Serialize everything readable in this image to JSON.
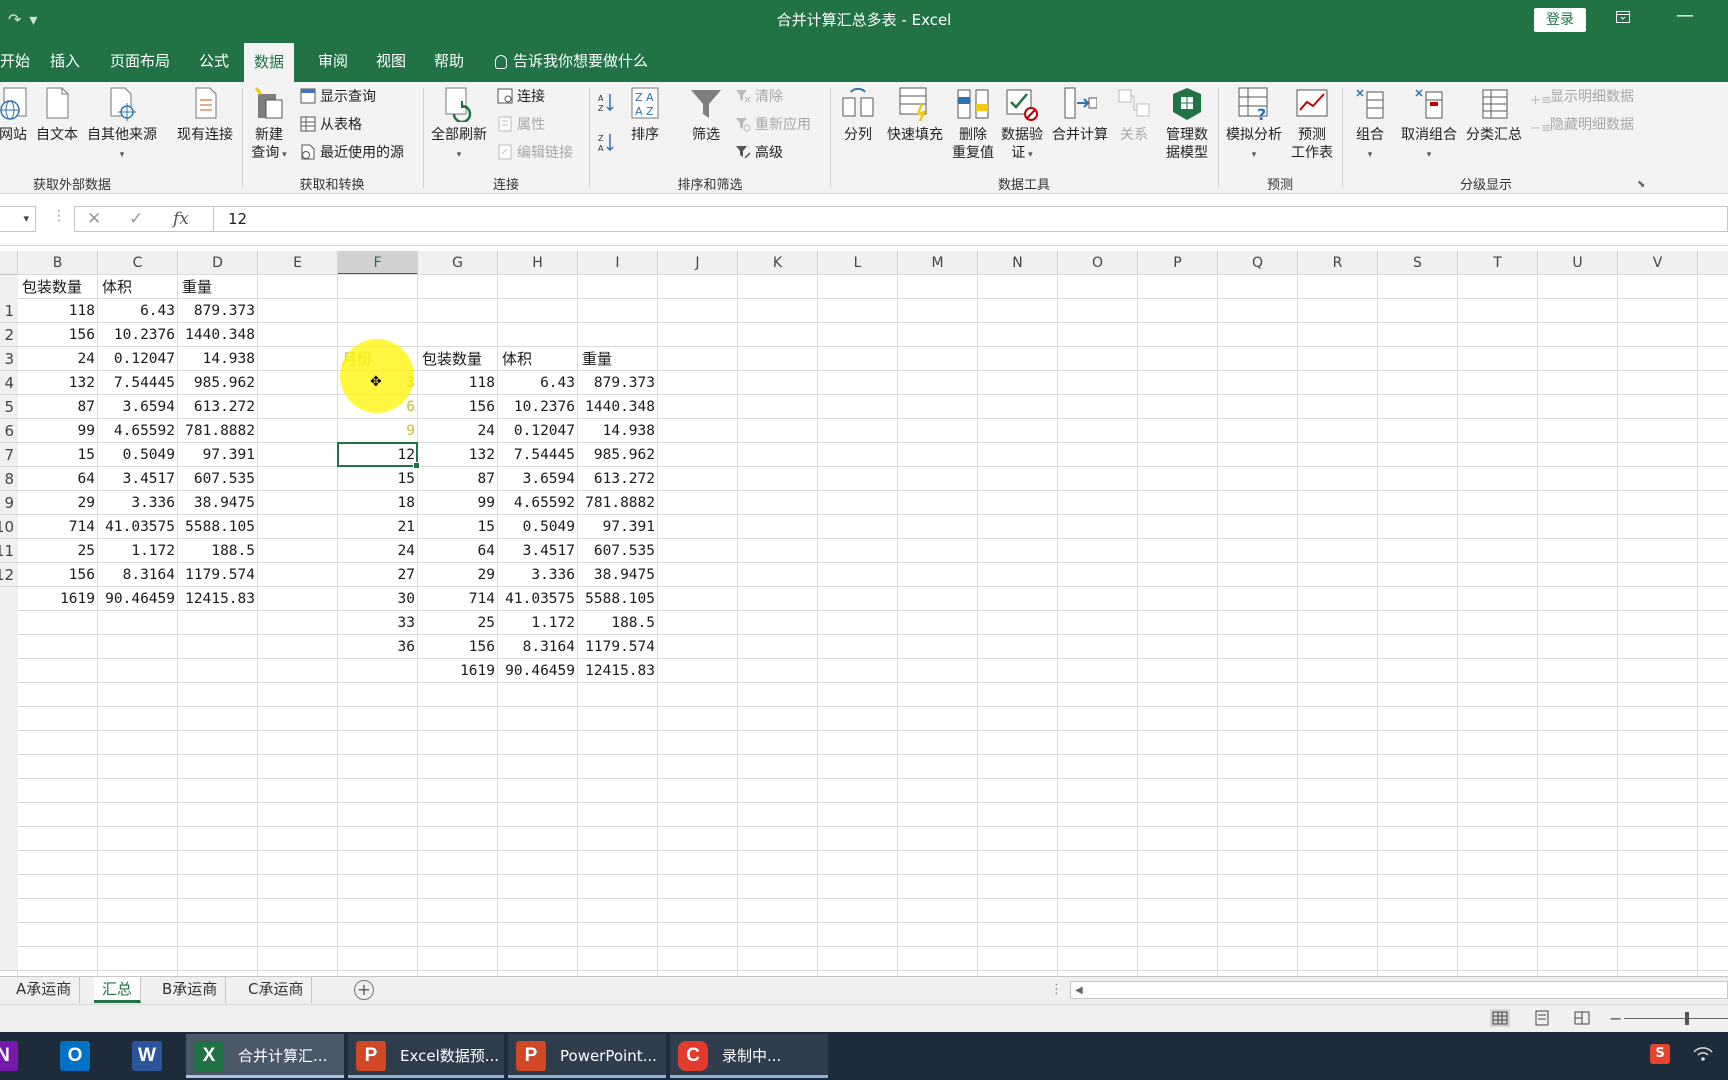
{
  "window": {
    "title": "合并计算汇总多表 - Excel",
    "login_label": "登录",
    "restore_icon": "ribbon-display-icon",
    "minimize_glyph": "—"
  },
  "tabs": [
    "开始",
    "插入",
    "页面布局",
    "公式",
    "数据",
    "审阅",
    "视图",
    "帮助"
  ],
  "active_tab": "数据",
  "tell_me": "告诉我你想要做什么",
  "ribbon": {
    "get_external": {
      "label": "获取外部数据",
      "buttons": [
        "网站",
        "自文本",
        "自其他来源",
        "现有连接"
      ]
    },
    "get_transform": {
      "label": "获取和转换",
      "new_query_line1": "新建",
      "new_query_line2": "查询",
      "small": [
        "显示查询",
        "从表格",
        "最近使用的源"
      ]
    },
    "connections": {
      "label": "连接",
      "refresh_all": "全部刷新",
      "small": [
        "连接",
        "属性",
        "编辑链接"
      ]
    },
    "sort_filter": {
      "label": "排序和筛选",
      "sort": "排序",
      "filter": "筛选",
      "small": [
        "清除",
        "重新应用",
        "高级"
      ]
    },
    "data_tools": {
      "label": "数据工具",
      "split": "分列",
      "flash_fill": "快速填充",
      "remove_dup_line1": "删除",
      "remove_dup_line2": "重复值",
      "validation_line1": "数据验",
      "validation_line2": "证",
      "consolidate": "合并计算",
      "relationships": "关系",
      "data_model_line1": "管理数",
      "data_model_line2": "据模型"
    },
    "forecast": {
      "label": "预测",
      "what_if": "模拟分析",
      "forecast_sheet_line1": "预测",
      "forecast_sheet_line2": "工作表"
    },
    "outline": {
      "label": "分级显示",
      "group": "组合",
      "ungroup": "取消组合",
      "subtotal": "分类汇总",
      "show_detail": "显示明细数据",
      "hide_detail": "隐藏明细数据"
    }
  },
  "formula_bar": {
    "cancel_glyph": "✕",
    "enter_glyph": "✓",
    "fx_label": "fx",
    "value": "12"
  },
  "columns": [
    "B",
    "C",
    "D",
    "E",
    "F",
    "G",
    "H",
    "I",
    "J",
    "K",
    "L",
    "M",
    "N",
    "O",
    "P",
    "Q",
    "R",
    "S",
    "T",
    "U",
    "V"
  ],
  "selected_column": "F",
  "row_headers": [
    "1",
    "2",
    "3",
    "4",
    "5",
    "6",
    "7",
    "8",
    "9",
    "10",
    "11",
    "12"
  ],
  "left_table": {
    "headers": [
      "包装数量",
      "体积",
      "重量"
    ],
    "rows": [
      [
        "118",
        "6.43",
        "879.373"
      ],
      [
        "156",
        "10.2376",
        "1440.348"
      ],
      [
        "24",
        "0.12047",
        "14.938"
      ],
      [
        "132",
        "7.54445",
        "985.962"
      ],
      [
        "87",
        "3.6594",
        "613.272"
      ],
      [
        "99",
        "4.65592",
        "781.8882"
      ],
      [
        "15",
        "0.5049",
        "97.391"
      ],
      [
        "64",
        "3.4517",
        "607.535"
      ],
      [
        "29",
        "3.336",
        "38.9475"
      ],
      [
        "714",
        "41.03575",
        "5588.105"
      ],
      [
        "25",
        "1.172",
        "188.5"
      ],
      [
        "156",
        "8.3164",
        "1179.574"
      ],
      [
        "1619",
        "90.46459",
        "12415.83"
      ]
    ]
  },
  "right_table": {
    "headers": [
      "月份",
      "包装数量",
      "体积",
      "重量"
    ],
    "rows": [
      [
        "3",
        "118",
        "6.43",
        "879.373"
      ],
      [
        "6",
        "156",
        "10.2376",
        "1440.348"
      ],
      [
        "9",
        "24",
        "0.12047",
        "14.938"
      ],
      [
        "12",
        "132",
        "7.54445",
        "985.962"
      ],
      [
        "15",
        "87",
        "3.6594",
        "613.272"
      ],
      [
        "18",
        "99",
        "4.65592",
        "781.8882"
      ],
      [
        "21",
        "15",
        "0.5049",
        "97.391"
      ],
      [
        "24",
        "64",
        "3.4517",
        "607.535"
      ],
      [
        "27",
        "29",
        "3.336",
        "38.9475"
      ],
      [
        "30",
        "714",
        "41.03575",
        "5588.105"
      ],
      [
        "33",
        "25",
        "1.172",
        "188.5"
      ],
      [
        "36",
        "156",
        "8.3164",
        "1179.574"
      ],
      [
        "",
        "1619",
        "90.46459",
        "12415.83"
      ]
    ]
  },
  "sheets": [
    "A承运商",
    "汇总",
    "B承运商",
    "C承运商"
  ],
  "active_sheet": "汇总",
  "add_sheet_glyph": "+",
  "taskbar": {
    "apps": [
      {
        "icon": "onenote-icon",
        "letter": "N",
        "label": ""
      },
      {
        "icon": "outlook-icon",
        "letter": "O",
        "label": ""
      },
      {
        "icon": "word-icon",
        "letter": "W",
        "label": ""
      },
      {
        "icon": "excel-icon",
        "letter": "X",
        "label": "合并计算汇..."
      },
      {
        "icon": "powerpoint-icon",
        "letter": "P",
        "label": "Excel数据预..."
      },
      {
        "icon": "powerpoint-icon",
        "letter": "P",
        "label": "PowerPoint..."
      },
      {
        "icon": "recorder-icon",
        "letter": "C",
        "label": "录制中..."
      }
    ],
    "tray_ime": "S"
  },
  "colors": {
    "excel_green": "#217346",
    "highlight_yellow": "#fff400",
    "taskbar": "#1e2b3a"
  }
}
